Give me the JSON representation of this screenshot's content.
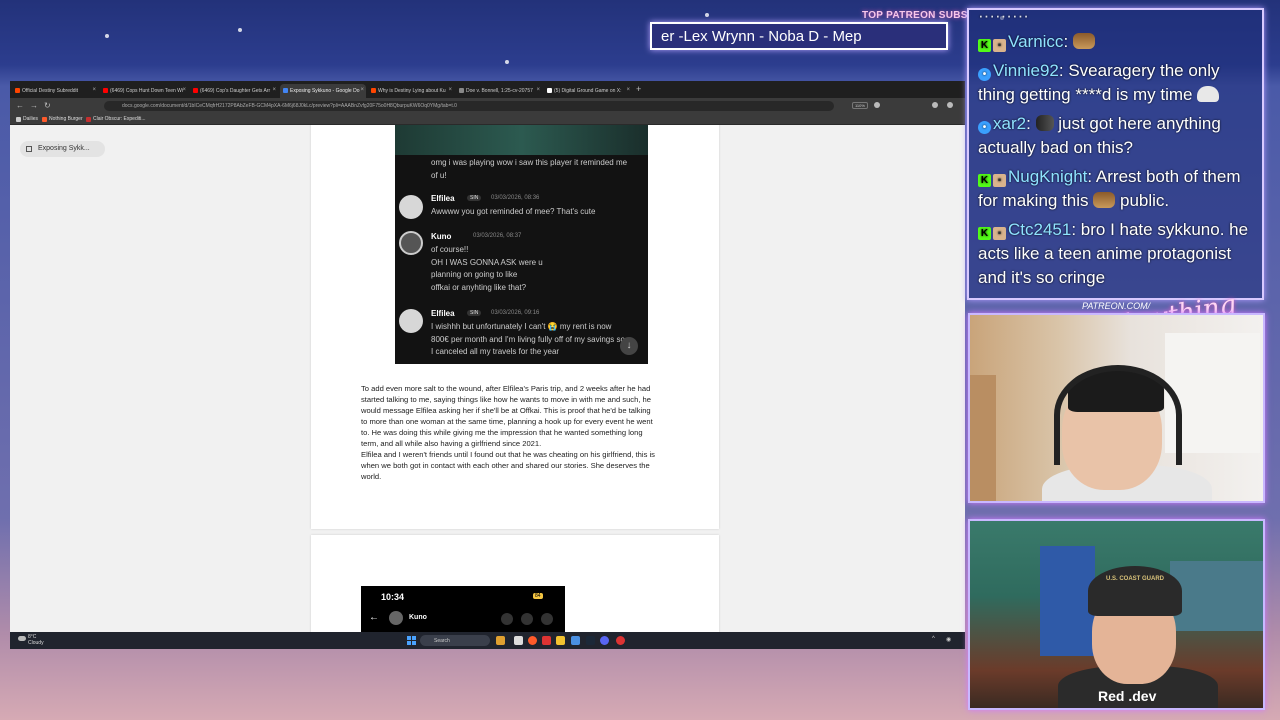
{
  "overlay": {
    "patreon_label": "TOP PATREON SUBS",
    "ticker_text": "er -Lex Wrynn -  Noba D - Mep"
  },
  "browser": {
    "tabs": [
      {
        "label": "Official Destiny Subreddit",
        "color": "#ff4500"
      },
      {
        "label": "(6469) Cops Hunt Down Teen Wi",
        "color": "#ff0000"
      },
      {
        "label": "(6469) Cop's Daughter Gets Arr",
        "color": "#ff0000"
      },
      {
        "label": "Exposing Sykkuno - Google Do",
        "color": "#4285f4",
        "active": true
      },
      {
        "label": "Why is Destiny Lying about Ku",
        "color": "#ff4500"
      },
      {
        "label": "Doe v. Bonnell, 1:25-cv-20757",
        "color": "#888888"
      },
      {
        "label": "(5) Digital Ground Game on X:",
        "color": "#ffffff"
      }
    ],
    "url": "docs.google.com/document/d/1bICeCMqfrH2172P8AbZeFB-GCM4pXA-6M6j68J0kLc/preview?pli=AAABnZvfg20F75o0H8QburpuKW6Oq0YMg/tab=t.0",
    "zoom": "110%",
    "bookmarks": [
      {
        "label": "Dailies",
        "color": "#cccccc"
      },
      {
        "label": "Nothing Burger",
        "color": "#ff5a2a"
      },
      {
        "label": "Clair Obscur: Expediti...",
        "color": "#c43030"
      }
    ],
    "outline_item": "Exposing Sykk..."
  },
  "discord": {
    "top_message": [
      "omg i was playing wow i saw this player it reminded me",
      "of u!"
    ],
    "messages": [
      {
        "name": "Elfilea",
        "badge": "SIN",
        "time": "03/03/2026, 08:36",
        "lines": [
          "Awwww you got reminded of mee? That's cute"
        ]
      },
      {
        "name": "Kuno",
        "badge": "",
        "time": "03/03/2026, 08:37",
        "lines": [
          "of course!!",
          "OH I WAS GONNA ASK were u",
          "planning on going to like",
          "offkai or anyhting like that?"
        ]
      },
      {
        "name": "Elfilea",
        "badge": "SIN",
        "time": "03/03/2026, 09:16",
        "lines": [
          "I wishhh but unfortunately I can't 😭 my rent is now",
          "800€ per month and I'm living fully off of my savings so",
          "I canceled all my travels for the year"
        ]
      }
    ]
  },
  "document": {
    "paragraph_lines": [
      "To add even more salt to the wound, after Elfilea's Paris trip, and 2 weeks after he had",
      "started talking to me, saying things like how he wants to move in with me and such, he",
      "would message Elfilea asking her if she'll be at Offkai. This is proof that he'd be talking",
      "to more than one woman at the same time, planning a hook up for every event he went",
      "to. He was doing this while giving me the impression that he wanted something long",
      "term, and all while also having a girlfriend since 2021.",
      "Elfilea and I weren't friends until I found out that he was cheating on his girlfriend, this is",
      "when we both got in contact with each other and shared our stories. She deserves the",
      "world."
    ],
    "phone": {
      "time": "10:34",
      "battery": "84",
      "contact": "Kuno"
    }
  },
  "taskbar": {
    "weather_temp": "8°C",
    "weather_desc": "Cloudy",
    "search_label": "Search"
  },
  "chat": {
    "messages": [
      {
        "user": "Varnicc",
        "text": "",
        "emote": "chest",
        "badges": [
          "k",
          "p"
        ]
      },
      {
        "user": "Vinnie92",
        "text": " Svearagery the only thing getting ****d is my time ",
        "emote": "ghost",
        "badges": [
          "v"
        ]
      },
      {
        "user": "xar2",
        "text": " just got here anything actually bad on this?",
        "emote": "can",
        "badges": [
          "v"
        ]
      },
      {
        "user": "NugKnight",
        "text": " Arrest both of them for making this ",
        "emote": "chest",
        "badges": [
          "k",
          "p"
        ],
        "after": " public."
      },
      {
        "user": "Ctc2451",
        "text": " bro I hate sykkuno. he acts like a teen anime protagonist and it's so cringe",
        "emote": "",
        "badges": [
          "k",
          "p"
        ]
      }
    ]
  },
  "branding": {
    "patreon_url": "PATREON.COM/",
    "script_logo": "Anything Else?",
    "mic_label": "Red    .dev",
    "cap_text": "U.S. COAST GUARD"
  },
  "colors": {
    "chat_username": "#8fe3ff",
    "accent_glow": "#d27aff",
    "kick_green": "#53fc18"
  }
}
